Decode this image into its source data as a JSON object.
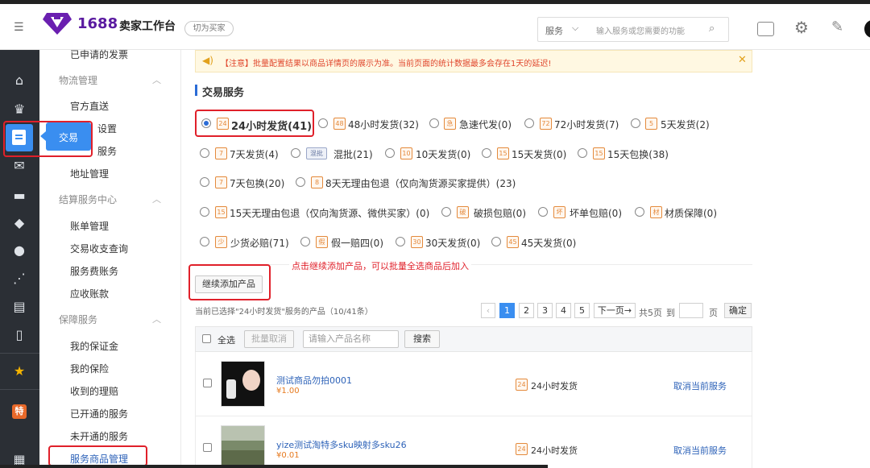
{
  "header": {
    "brand": "1688",
    "title": "卖家工作台",
    "switch_label": "切为买家",
    "service_label": "服务",
    "search_placeholder": "输入服务或您需要的功能"
  },
  "sidebar": {
    "top_item": "已申请的发票",
    "group_logistics": "物流管理",
    "logistics_items": [
      "官方直送",
      "设置",
      "服务",
      "地址管理"
    ],
    "group_settle": "结算服务中心",
    "settle_items": [
      "账单管理",
      "交易收支查询",
      "服务费账务",
      "应收账款"
    ],
    "group_guarantee": "保障服务",
    "guarantee_items": [
      "我的保证金",
      "我的保险",
      "收到的理赔",
      "已开通的服务",
      "未开通的服务",
      "服务商品管理"
    ],
    "tooltip": "交易"
  },
  "notice": {
    "text": "【注意】批量配置结果以商品详情页的展示为准。当前页面的统计数据最多会存在1天的延迟!"
  },
  "section_title": "交易服务",
  "services": {
    "row1": [
      "24小时发货(41)",
      "48小时发货(32)",
      "急速代发(0)",
      "72小时发货(7)",
      "5天发货(2)"
    ],
    "row2": [
      "7天发货(4)",
      "混批(21)",
      "10天发货(0)",
      "15天发货(0)",
      "15天包换(38)"
    ],
    "row3": [
      "7天包换(20)",
      "8天无理由包退（仅向淘货源买家提供）(23)"
    ],
    "row4": [
      "15天无理由包退（仅向淘货源、微供买家）(0)",
      "破损包赔(0)",
      "坏单包赔(0)",
      "材质保障(0)"
    ],
    "row5": [
      "少货必赔(71)",
      "假一赔四(0)",
      "30天发货(0)",
      "45天发货(0)"
    ],
    "icons": {
      "r1": [
        "24",
        "48",
        "急",
        "72",
        "5"
      ],
      "r2": [
        "7",
        "混批",
        "10",
        "15",
        "15"
      ],
      "r3": [
        "7",
        "8"
      ],
      "r4": [
        "15",
        "破",
        "坏",
        "材"
      ],
      "r5": [
        "少",
        "假",
        "30",
        "45"
      ]
    }
  },
  "annotation": "点击继续添加产品，可以批量全选商品后加入",
  "add_button": "继续添加产品",
  "summary": "当前已选择\"24小时发货\"服务的产品（10/41条）",
  "pagination": {
    "prev": "‹",
    "pages": [
      "1",
      "2",
      "3",
      "4",
      "5"
    ],
    "next": "下一页→",
    "total": "共5页",
    "goto": "到",
    "page_unit": "页",
    "confirm": "确定"
  },
  "toolbar": {
    "select_all": "全选",
    "batch_cancel": "批量取消",
    "search_placeholder": "请输入产品名称",
    "search_button": "搜索"
  },
  "products": [
    {
      "name": "测试商品勿拍0001",
      "price": "¥1.00",
      "service": "24小时发货",
      "action": "取消当前服务"
    },
    {
      "name": "yize测试淘特多sku映射多sku26",
      "price": "¥0.01",
      "service": "24小时发货",
      "action": "取消当前服务"
    }
  ],
  "colors": {
    "accent": "#2b6cd6",
    "danger": "#e0202a",
    "price": "#e67a1f",
    "notice_bg": "#fff8e2",
    "rail": "#2b2f35"
  }
}
